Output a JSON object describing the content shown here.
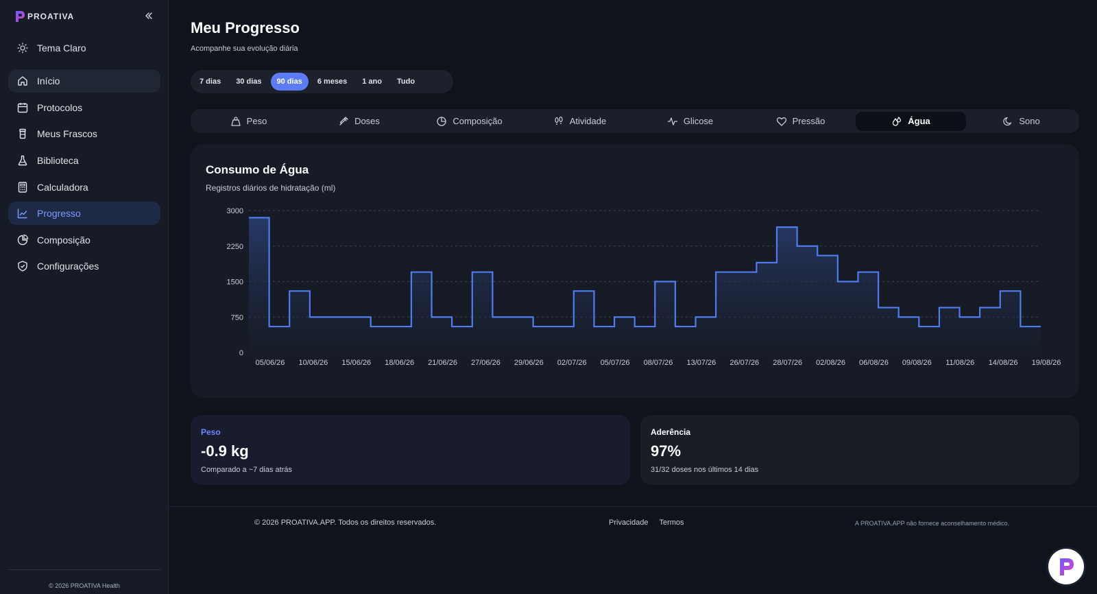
{
  "brand": {
    "name": "PROATIVA"
  },
  "sidebar": {
    "theme_label": "Tema Claro",
    "items": [
      {
        "label": "Início"
      },
      {
        "label": "Protocolos"
      },
      {
        "label": "Meus Frascos"
      },
      {
        "label": "Biblioteca"
      },
      {
        "label": "Calculadora"
      },
      {
        "label": "Progresso"
      },
      {
        "label": "Composição"
      },
      {
        "label": "Configurações"
      }
    ],
    "footer": "© 2026 PROATIVA Health"
  },
  "page": {
    "title": "Meu Progresso",
    "subtitle": "Acompanhe sua evolução diária"
  },
  "range_tabs": [
    "7 dias",
    "30 dias",
    "90 dias",
    "6 meses",
    "1 ano",
    "Tudo"
  ],
  "range_selected": "90 dias",
  "metric_tabs": [
    "Peso",
    "Doses",
    "Composição",
    "Atividade",
    "Glicose",
    "Pressão",
    "Água",
    "Sono"
  ],
  "metric_selected": "Água",
  "chart": {
    "title": "Consumo de Água",
    "subtitle": "Registros diários de hidratação (ml)"
  },
  "chart_data": {
    "type": "area",
    "step": true,
    "title": "Consumo de Água",
    "subtitle": "Registros diários de hidratação (ml)",
    "ylim": [
      0,
      3000
    ],
    "yticks": [
      0,
      750,
      1500,
      2250,
      3000
    ],
    "grid": true,
    "xtick_labels": [
      "05/06/26",
      "10/06/26",
      "15/06/26",
      "18/06/26",
      "21/06/26",
      "27/06/26",
      "29/06/26",
      "02/07/26",
      "05/07/26",
      "08/07/26",
      "13/07/26",
      "26/07/26",
      "28/07/26",
      "02/08/26",
      "06/08/26",
      "09/08/26",
      "11/08/26",
      "14/08/26",
      "19/08/26"
    ],
    "series": [
      {
        "values": [
          2850,
          550,
          1300,
          750,
          750,
          750,
          550,
          550,
          1700,
          750,
          550,
          1700,
          750,
          750,
          550,
          550,
          1300,
          550,
          750,
          550,
          1500,
          550,
          750,
          1700,
          1700,
          1900,
          2650,
          2250,
          2050,
          1500,
          1700,
          950,
          750,
          550,
          950,
          750,
          950,
          1300,
          550
        ]
      }
    ],
    "color": "#4f7cf0"
  },
  "stats": {
    "weight": {
      "label": "Peso",
      "value": "-0.9 kg",
      "desc": "Comparado a ~7 dias atrás"
    },
    "adherence": {
      "label": "Aderência",
      "value": "97%",
      "desc": "31/32 doses nos últimos 14 dias"
    }
  },
  "footer": {
    "copyright": "© 2026 PROATIVA.APP. Todos os direitos reservados.",
    "links": [
      "Privacidade",
      "Termos"
    ],
    "disclaimer": "A PROATIVA.APP não fornece aconselhamento médico."
  }
}
